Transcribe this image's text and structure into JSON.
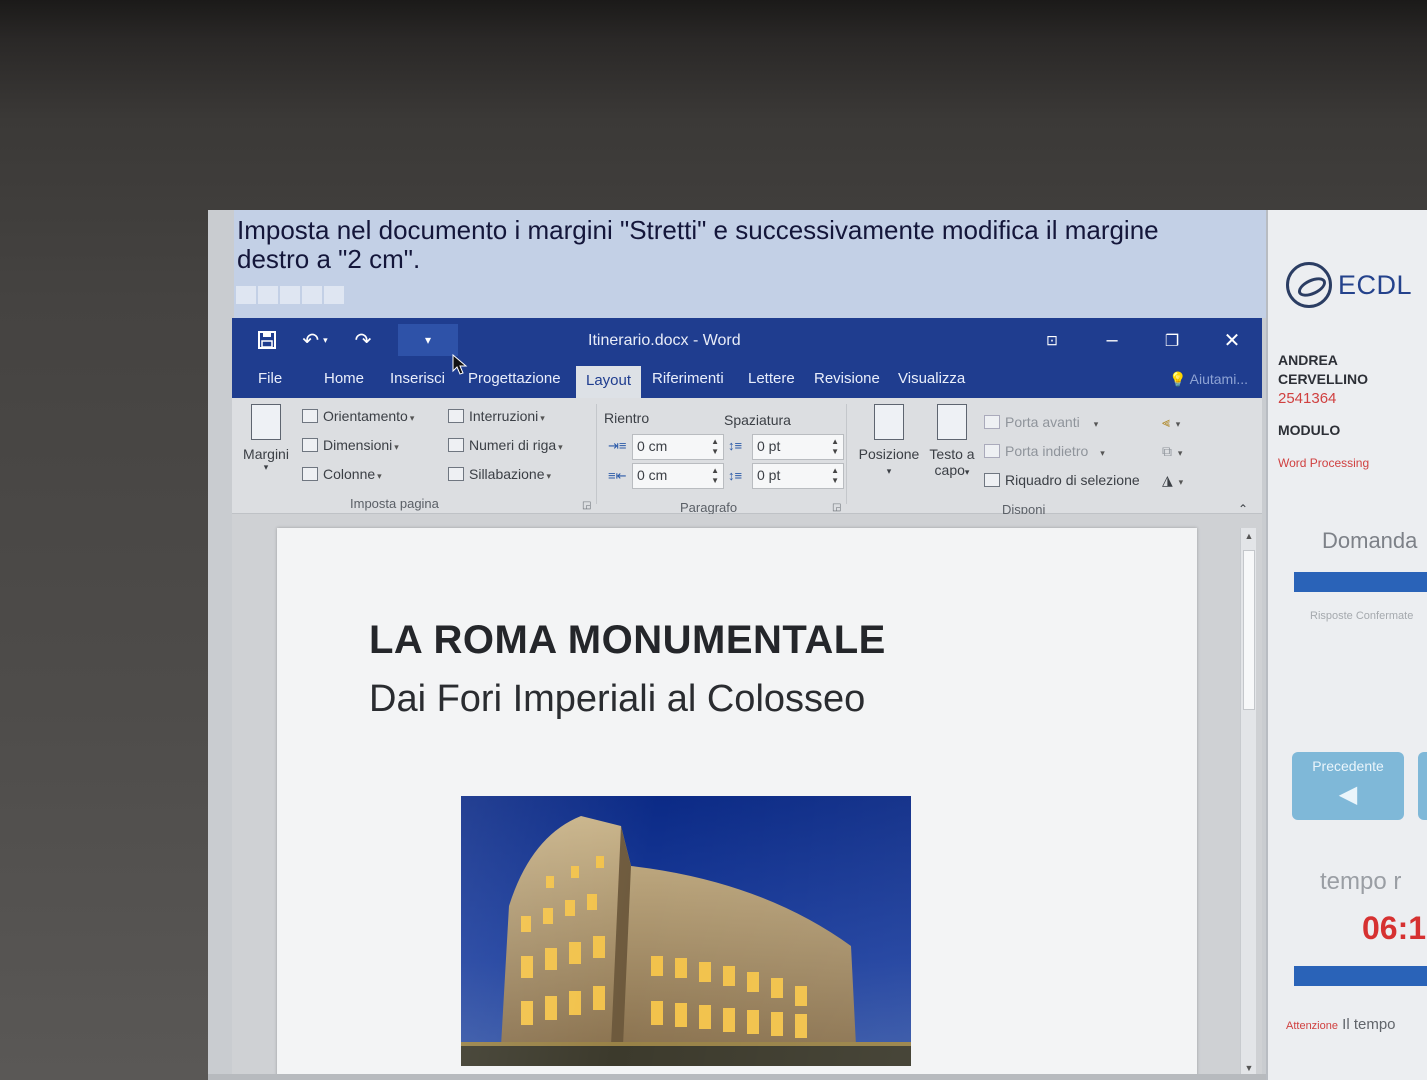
{
  "task": {
    "instruction": "Imposta nel documento i margini \"Stretti\" e successivamente modifica il margine destro a \"2 cm\"."
  },
  "word": {
    "title": "Itinerario.docx - Word",
    "tabs": [
      "File",
      "Home",
      "Inserisci",
      "Progettazione",
      "Layout",
      "Riferimenti",
      "Lettere",
      "Revisione",
      "Visualizza"
    ],
    "active_tab": "Layout",
    "help": "Aiutami...",
    "ribbon": {
      "margini": "Margini",
      "orientamento": "Orientamento",
      "dimensioni": "Dimensioni",
      "colonne": "Colonne",
      "interruzioni": "Interruzioni",
      "numeri_riga": "Numeri di riga",
      "sillabazione": "Sillabazione",
      "group_imposta": "Imposta pagina",
      "rientro": "Rientro",
      "spaziatura": "Spaziatura",
      "indent_left": "0 cm",
      "indent_right": "0 cm",
      "space_before": "0 pt",
      "space_after": "0 pt",
      "group_paragrafo": "Paragrafo",
      "posizione": "Posizione",
      "testo_a_capo_1": "Testo a",
      "testo_a_capo_2": "capo",
      "porta_avanti": "Porta avanti",
      "porta_indietro": "Porta indietro",
      "riquadro": "Riquadro di selezione",
      "group_disponi": "Disponi"
    }
  },
  "document": {
    "heading": "LA ROMA MONUMENTALE",
    "subtitle": "Dai Fori Imperiali al Colosseo"
  },
  "ecdl": {
    "logo": "ECDL",
    "first_name": "ANDREA",
    "last_name": "CERVELLINO",
    "id": "2541364",
    "module_label": "MODULO",
    "module_name": "Word Processing",
    "question_label": "Domanda",
    "question_note": "Risposte Confermate",
    "prev_button": "Precedente",
    "time_label": "tempo r",
    "time_value": "06:1",
    "warning_prefix": "Attenzione",
    "warning_text": "Il tempo"
  },
  "colors": {
    "word_blue": "#1f3d8f",
    "accent_red": "#d04040",
    "progress_blue": "#2a63b8"
  }
}
